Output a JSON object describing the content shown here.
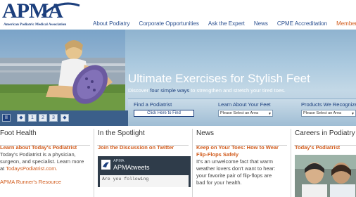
{
  "header": {
    "logo_text": "APMA",
    "logo_subtitle": "American Podiatric Medical Association",
    "nav": [
      {
        "label": "About Podiatry"
      },
      {
        "label": "Corporate Opportunities"
      },
      {
        "label": "Ask the Expert"
      },
      {
        "label": "News"
      },
      {
        "label": "CPME Accreditation"
      },
      {
        "label": "Members"
      }
    ]
  },
  "hero": {
    "title": "Ultimate Exercises for Stylish Feet",
    "subtitle_pre": "Discover ",
    "subtitle_highlight": "four simple ways",
    "subtitle_post": " to strengthen and stretch your tired toes."
  },
  "slider": {
    "pause": "II",
    "prev": "◆",
    "pages": [
      "1",
      "2",
      "3"
    ],
    "next": "◆"
  },
  "search": {
    "find": {
      "label": "Find a Podiatrist",
      "button": "Click Here to Find"
    },
    "learn": {
      "label": "Learn About Your Feet",
      "select": "Please Select an Area"
    },
    "products": {
      "label": "Products We Recognize",
      "select": "Please Select an Area"
    }
  },
  "columns": {
    "foot_health": {
      "heading": "Foot Health",
      "link_title": "Learn about Today's Podiatrist",
      "body_lines": [
        "Today's Podiatrist is a physician,",
        "surgeon, and specialist. Learn more"
      ],
      "body_link_pre": "at ",
      "body_link": "TodaysPodiatrist.com.",
      "link2": "APMA Runner's Resource"
    },
    "spotlight": {
      "heading": "In the Spotlight",
      "link_title": "Join the Discussion on Twitter",
      "tweets_apma": "APMA",
      "tweets_title": "APMAtweets",
      "tweets_body": "Are you following"
    },
    "news": {
      "heading": "News",
      "link_title_lines": [
        "Keep on Your Toes: How to Wear",
        "Flip-Flops Safely"
      ],
      "body_lines": [
        "It's an unwelcome fact that warm",
        "weather lovers don't want to hear:",
        "your favorite pair of flip-flops are",
        "bad for your health."
      ]
    },
    "careers": {
      "heading": "Careers in Podiatry",
      "link_title": "Today's Podiatrist"
    }
  },
  "colors": {
    "brand_blue": "#1c3f7d",
    "accent_orange": "#d15b1c",
    "slider_bar": "#3b5f8a"
  }
}
